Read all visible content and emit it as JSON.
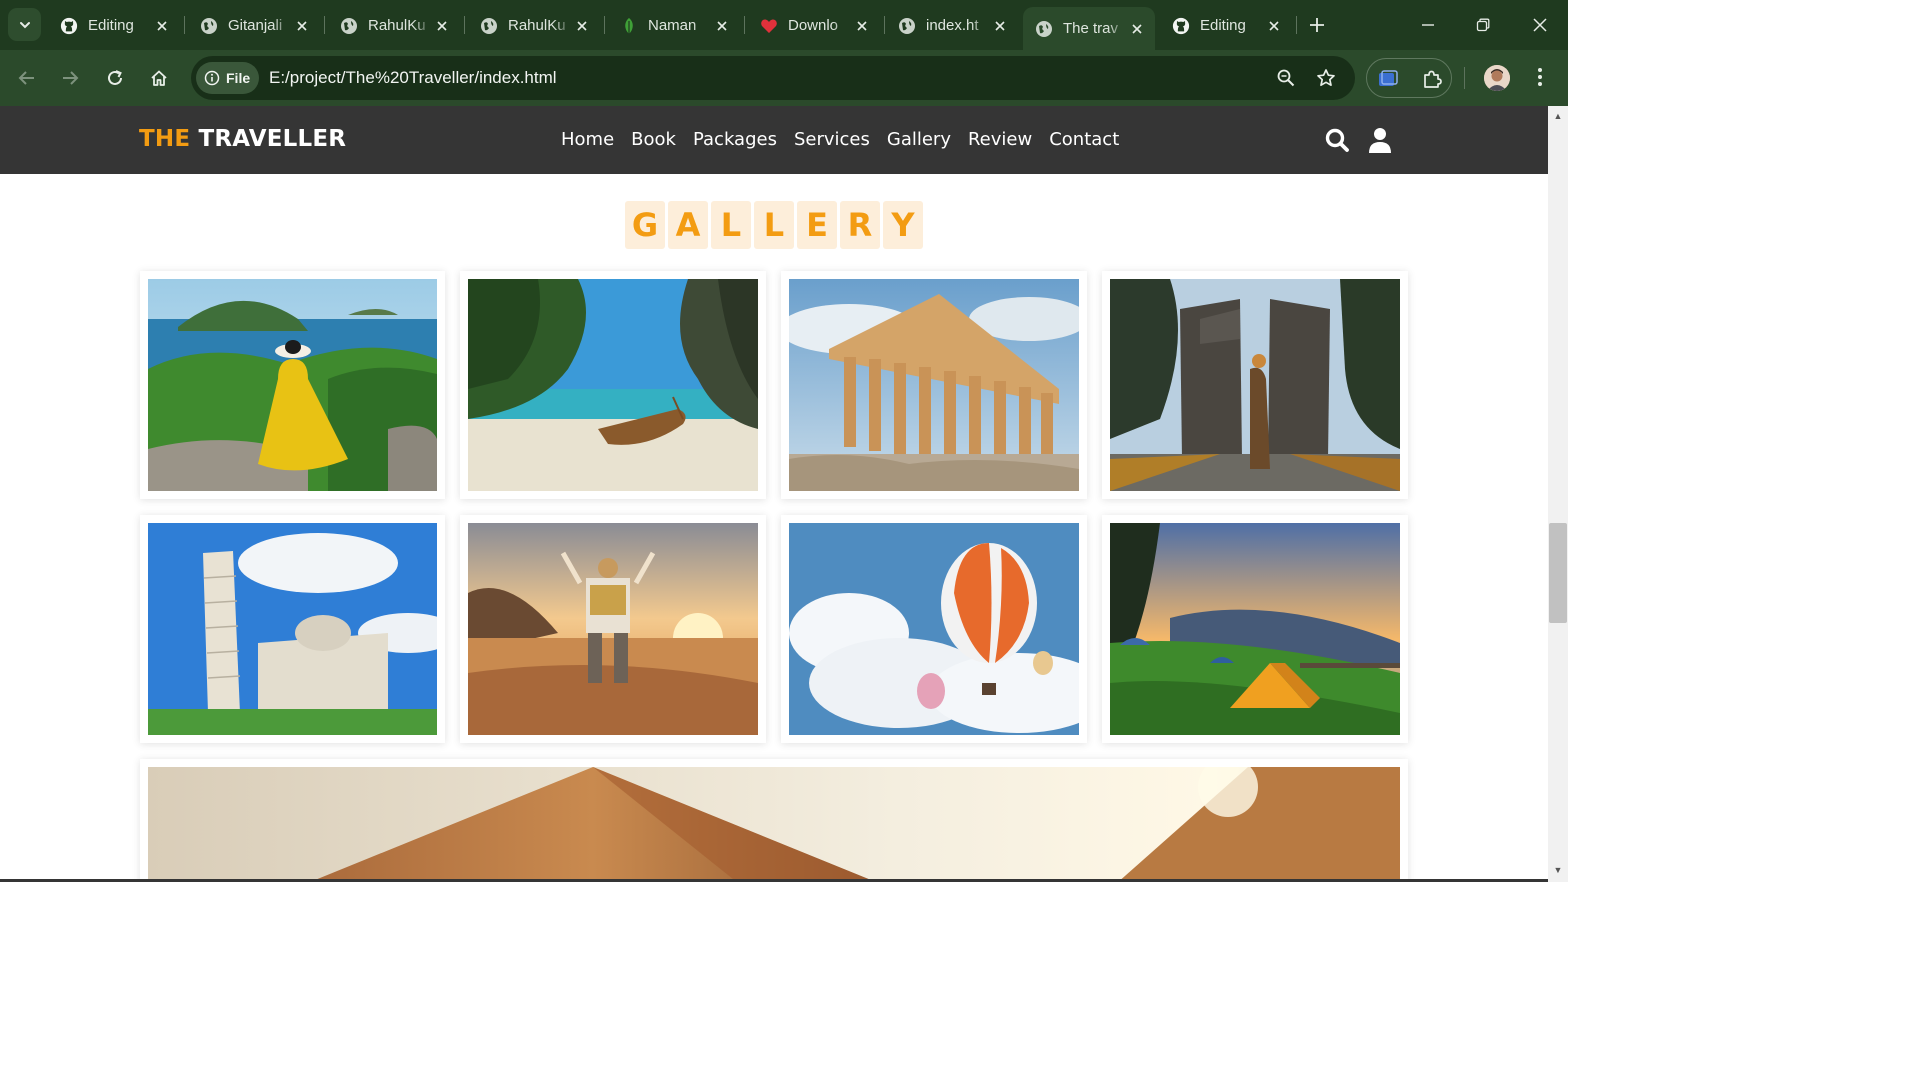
{
  "browser": {
    "tabs": [
      {
        "title": "Editing",
        "icon": "github-icon",
        "active": false
      },
      {
        "title": "Gitanjali",
        "icon": "globe-icon",
        "active": false
      },
      {
        "title": "RahulKu",
        "icon": "globe-icon",
        "active": false
      },
      {
        "title": "RahulKu",
        "icon": "globe-icon",
        "active": false
      },
      {
        "title": "Naman",
        "icon": "leaf-icon",
        "active": false
      },
      {
        "title": "Downlo",
        "icon": "heart-icon",
        "active": false
      },
      {
        "title": "index.ht",
        "icon": "globe-icon",
        "active": false
      },
      {
        "title": "The trav",
        "icon": "globe-icon",
        "active": true
      },
      {
        "title": "Editing",
        "icon": "github-icon",
        "active": false
      }
    ],
    "address": {
      "chip_label": "File",
      "url": "E:/project/The%20Traveller/index.html"
    }
  },
  "site": {
    "logo": {
      "accent": "THE",
      "rest": "TRAVELLER"
    },
    "nav": [
      "Home",
      "Book",
      "Packages",
      "Services",
      "Gallery",
      "Review",
      "Contact"
    ],
    "gallery_title": [
      "G",
      "A",
      "L",
      "L",
      "E",
      "R",
      "Y"
    ],
    "gallery_images": [
      "woman-yellow-dress-island-view",
      "longtail-boat-beach",
      "parthenon-ruins",
      "traveler-bali-temple-gate",
      "leaning-tower-of-pisa",
      "traveler-sunset-beach",
      "hot-air-balloons-clouds",
      "tents-mountain-sunset",
      "pyramids-desert"
    ]
  },
  "colors": {
    "accent": "#f39c12",
    "header_bg": "#353535",
    "title_letter_bg": "#fdeeda",
    "browser_frame": "#1f3a1f",
    "browser_toolbar": "#2b4a2b"
  }
}
